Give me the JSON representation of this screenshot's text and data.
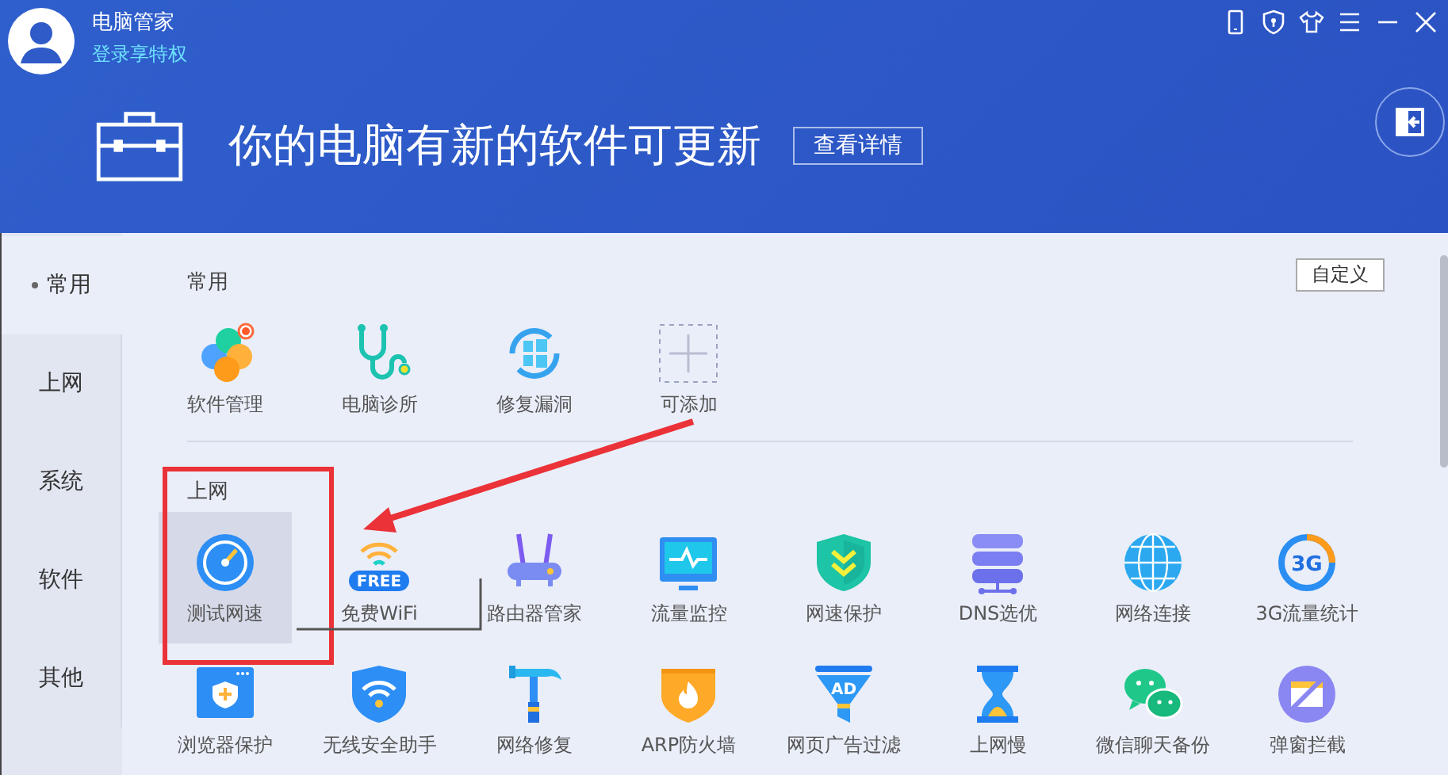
{
  "app": {
    "title": "电脑管家",
    "login_link": "登录享特权"
  },
  "banner": {
    "message": "你的电脑有新的软件可更新",
    "button": "查看详情"
  },
  "sidebar": {
    "items": [
      {
        "label": "常用",
        "selected": true
      },
      {
        "label": "上网",
        "selected": false
      },
      {
        "label": "系统",
        "selected": false
      },
      {
        "label": "软件",
        "selected": false
      },
      {
        "label": "其他",
        "selected": false
      }
    ]
  },
  "customize_button": "自定义",
  "sections": [
    {
      "title": "常用",
      "items": [
        {
          "label": "软件管理",
          "hovered": false
        },
        {
          "label": "电脑诊所",
          "hovered": false
        },
        {
          "label": "修复漏洞",
          "hovered": false
        },
        {
          "label": "可添加",
          "hovered": false
        }
      ]
    },
    {
      "title": "上网",
      "items": [
        {
          "label": "测试网速",
          "hovered": true
        },
        {
          "label": "免费WiFi",
          "icon_text": "FREE",
          "hovered": false
        },
        {
          "label": "路由器管家",
          "hovered": false
        },
        {
          "label": "流量监控",
          "hovered": false
        },
        {
          "label": "网速保护",
          "hovered": false
        },
        {
          "label": "DNS选优",
          "hovered": false
        },
        {
          "label": "网络连接",
          "hovered": false
        },
        {
          "label": "3G流量统计",
          "icon_text": "3G",
          "hovered": false
        },
        {
          "label": "浏览器保护",
          "hovered": false
        },
        {
          "label": "无线安全助手",
          "hovered": false
        },
        {
          "label": "网络修复",
          "hovered": false
        },
        {
          "label": "ARP防火墙",
          "hovered": false
        },
        {
          "label": "网页广告过滤",
          "icon_text": "AD",
          "hovered": false
        },
        {
          "label": "上网慢",
          "hovered": false
        },
        {
          "label": "微信聊天备份",
          "hovered": false
        },
        {
          "label": "弹窗拦截",
          "hovered": false
        }
      ]
    }
  ]
}
